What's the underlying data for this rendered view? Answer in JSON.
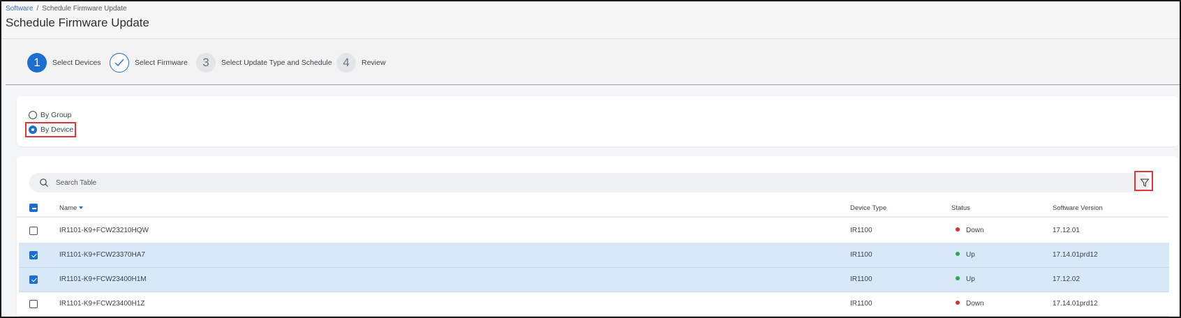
{
  "breadcrumb": {
    "parent": "Software",
    "separator": "/",
    "current": "Schedule Firmware Update"
  },
  "page_title": "Schedule Firmware Update",
  "wizard": {
    "steps": [
      {
        "number": "1",
        "label": "Select Devices",
        "state": "active"
      },
      {
        "number": "",
        "label": "Select Firmware",
        "state": "completed"
      },
      {
        "number": "3",
        "label": "Select Update Type and Schedule",
        "state": "pending"
      },
      {
        "number": "4",
        "label": "Review",
        "state": "pending"
      }
    ]
  },
  "selection": {
    "options": [
      {
        "label": "By Group",
        "selected": false
      },
      {
        "label": "By Device",
        "selected": true
      }
    ]
  },
  "table": {
    "search_placeholder": "Search Table",
    "columns": [
      "Name",
      "Device Type",
      "Status",
      "Software Version"
    ],
    "sort_column": "Name",
    "rows": [
      {
        "name": "IR1101-K9+FCW23210HQW",
        "device_type": "IR1100",
        "status": "Down",
        "status_color": "#d93025",
        "software_version": "17.12.01",
        "selected": false
      },
      {
        "name": "IR1101-K9+FCW23370HA7",
        "device_type": "IR1100",
        "status": "Up",
        "status_color": "#2ea84f",
        "software_version": "17.14.01prd12",
        "selected": true
      },
      {
        "name": "IR1101-K9+FCW23400H1M",
        "device_type": "IR1100",
        "status": "Up",
        "status_color": "#2ea84f",
        "software_version": "17.12.02",
        "selected": true
      },
      {
        "name": "IR1101-K9+FCW23400H1Z",
        "device_type": "IR1100",
        "status": "Down",
        "status_color": "#d93025",
        "software_version": "17.14.01prd12",
        "selected": false
      }
    ]
  },
  "colors": {
    "accent": "#1c6ed1",
    "highlight": "#e0353a",
    "row_selected": "#d9e8f7"
  },
  "icons": {
    "search": "search-icon",
    "filter": "filter-icon",
    "check": "checkmark-icon"
  }
}
